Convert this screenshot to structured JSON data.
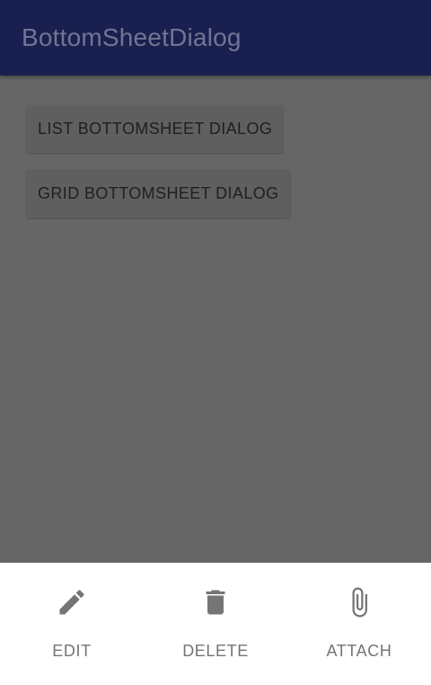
{
  "app_bar": {
    "title": "BottomSheetDialog"
  },
  "buttons": [
    {
      "label": "LIST BOTTOMSHEET DIALOG"
    },
    {
      "label": "GRID BOTTOMSHEET DIALOG"
    }
  ],
  "bottom_sheet": {
    "items": [
      {
        "label": "EDIT",
        "icon": "pencil-icon"
      },
      {
        "label": "DELETE",
        "icon": "trash-icon"
      },
      {
        "label": "ATTACH",
        "icon": "paperclip-icon"
      }
    ],
    "icon_color": "#757575"
  },
  "colors": {
    "app_bar": "#19204f",
    "scrim": "#666666",
    "sheet": "#ffffff"
  }
}
